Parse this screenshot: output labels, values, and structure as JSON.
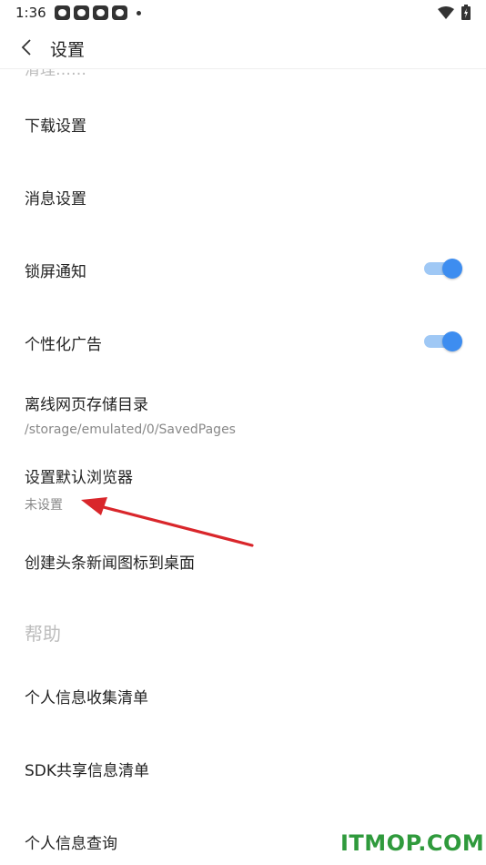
{
  "status_bar": {
    "time": "1:36",
    "notification_icons": [
      "app-notification-icon",
      "app-notification-icon",
      "app-notification-icon",
      "app-notification-icon"
    ],
    "icons": [
      "wifi-icon",
      "battery-charging-icon"
    ]
  },
  "app_bar": {
    "back_icon": "chevron-left-icon",
    "title": "设置"
  },
  "settings": {
    "cut_off_item": "清理……",
    "download": {
      "label": "下载设置"
    },
    "messages": {
      "label": "消息设置"
    },
    "lockscreen": {
      "label": "锁屏通知",
      "enabled": true
    },
    "personalized_ads": {
      "label": "个性化广告",
      "enabled": true
    },
    "offline_dir": {
      "label": "离线网页存储目录",
      "value": "/storage/emulated/0/SavedPages"
    },
    "default_browser": {
      "label": "设置默认浏览器",
      "value": "未设置"
    },
    "desktop_icon": {
      "label": "创建头条新闻图标到桌面"
    }
  },
  "help": {
    "header": "帮助",
    "personal_info_list": {
      "label": "个人信息收集清单"
    },
    "sdk_list": {
      "label": "SDK共享信息清单"
    },
    "personal_info_query": {
      "label": "个人信息查询"
    }
  },
  "annotation": {
    "color": "#d9262b"
  },
  "watermark": {
    "text": "ITMOP.COM",
    "color": "#2f9a3c"
  },
  "colors": {
    "toggle_on": "#3d8df0",
    "toggle_track": "#9fc8f5"
  }
}
